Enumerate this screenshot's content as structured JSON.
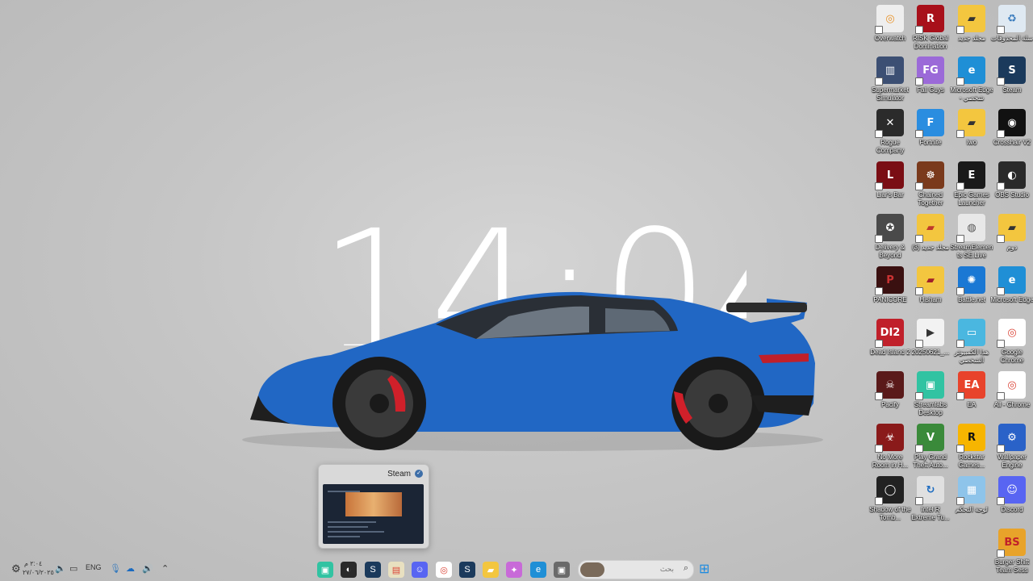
{
  "clock": {
    "time": "14:04"
  },
  "desktop_icons": [
    {
      "label": "Overwatch",
      "color": "#eeeeee",
      "fg": "#e8932a",
      "glyph": "◎"
    },
    {
      "label": "RISK Global Domination",
      "color": "#a8101a",
      "fg": "#ffffff",
      "glyph": "R"
    },
    {
      "label": "مجلد جديد",
      "color": "#f3c63f",
      "fg": "#333333",
      "glyph": "▰"
    },
    {
      "label": "سلة المحذوفات",
      "color": "#dfe9f2",
      "fg": "#3a7cbd",
      "glyph": "♻"
    },
    {
      "label": "Supermarket Simulator",
      "color": "#3c4f73",
      "fg": "#ffffff",
      "glyph": "▥"
    },
    {
      "label": "Fall Guys",
      "color": "#9b6ad8",
      "fg": "#ffffff",
      "glyph": "FG"
    },
    {
      "label": "Microsoft Edge - شخصي",
      "color": "#1f8fd6",
      "fg": "#ffffff",
      "glyph": "e"
    },
    {
      "label": "Steam",
      "color": "#1b3a5c",
      "fg": "#ffffff",
      "glyph": "S"
    },
    {
      "label": "Rogue Company",
      "color": "#2b2b2b",
      "fg": "#ffffff",
      "glyph": "✕"
    },
    {
      "label": "Fortnite",
      "color": "#2a8de0",
      "fg": "#ffffff",
      "glyph": "F"
    },
    {
      "label": "Iwo",
      "color": "#f3c63f",
      "fg": "#333333",
      "glyph": "▰"
    },
    {
      "label": "Crosshair V2",
      "color": "#111111",
      "fg": "#ffffff",
      "glyph": "◉"
    },
    {
      "label": "Liar's Bar",
      "color": "#7a0e14",
      "fg": "#ffffff",
      "glyph": "L"
    },
    {
      "label": "Chained Together",
      "color": "#7a3a1c",
      "fg": "#ffffff",
      "glyph": "☸"
    },
    {
      "label": "Epic Games Launcher",
      "color": "#1a1a1a",
      "fg": "#ffffff",
      "glyph": "E"
    },
    {
      "label": "OBS Studio",
      "color": "#2a2a2a",
      "fg": "#ffffff",
      "glyph": "◐"
    },
    {
      "label": "Delivery & Beyond",
      "color": "#4a4a4a",
      "fg": "#ffffff",
      "glyph": "✪"
    },
    {
      "label": "مجلد جديد (3)",
      "color": "#f3c63f",
      "fg": "#c0392b",
      "glyph": "▰"
    },
    {
      "label": "StreamElements SE.Live",
      "color": "#e8e8e8",
      "fg": "#555555",
      "glyph": "◍"
    },
    {
      "label": "دوم",
      "color": "#f3c63f",
      "fg": "#333333",
      "glyph": "▰"
    },
    {
      "label": "PANICORE",
      "color": "#3a1010",
      "fg": "#cc3333",
      "glyph": "P"
    },
    {
      "label": "Hisham",
      "color": "#f3c63f",
      "fg": "#a0202a",
      "glyph": "▰"
    },
    {
      "label": "Battle.net",
      "color": "#1a78d4",
      "fg": "#ffffff",
      "glyph": "✺"
    },
    {
      "label": "Microsoft Edge",
      "color": "#1f8fd6",
      "fg": "#ffffff",
      "glyph": "e"
    },
    {
      "label": "Dead Island 2",
      "color": "#c0202a",
      "fg": "#ffffff",
      "glyph": "DI2"
    },
    {
      "label": "20250621_...",
      "color": "#f2f2f2",
      "fg": "#333333",
      "glyph": "▶"
    },
    {
      "label": "هذا الكمبيوتر الشخصي",
      "color": "#4ab7e0",
      "fg": "#ffffff",
      "glyph": "▭"
    },
    {
      "label": "Google Chrome",
      "color": "#ffffff",
      "fg": "#db4437",
      "glyph": "◎"
    },
    {
      "label": "Pacify",
      "color": "#5a1a1a",
      "fg": "#ffffff",
      "glyph": "☠"
    },
    {
      "label": "Streamlabs Desktop",
      "color": "#31c3a2",
      "fg": "#ffffff",
      "glyph": "▣"
    },
    {
      "label": "EA",
      "color": "#e8432b",
      "fg": "#ffffff",
      "glyph": "EA"
    },
    {
      "label": "All - Chrome",
      "color": "#ffffff",
      "fg": "#db4437",
      "glyph": "◎"
    },
    {
      "label": "No More Room in H...",
      "color": "#8a1a1a",
      "fg": "#ffffff",
      "glyph": "☣"
    },
    {
      "label": "Play Grand Theft Auto...",
      "color": "#3a8a3a",
      "fg": "#ffffff",
      "glyph": "V"
    },
    {
      "label": "Rockstar Games...",
      "color": "#f7b500",
      "fg": "#111111",
      "glyph": "R"
    },
    {
      "label": "Wallpaper Engine",
      "color": "#2a62c8",
      "fg": "#ffffff",
      "glyph": "⚙"
    },
    {
      "label": "Shadow of the Tomb...",
      "color": "#222222",
      "fg": "#ffffff",
      "glyph": "◯"
    },
    {
      "label": "Intel R Extreme Tu...",
      "color": "#e0e0e0",
      "fg": "#1a6ac0",
      "glyph": "↻"
    },
    {
      "label": "لوحة التحكم",
      "color": "#8ec4ea",
      "fg": "#ffffff",
      "glyph": "▦"
    },
    {
      "label": "Discord",
      "color": "#5865f2",
      "fg": "#ffffff",
      "glyph": "☺"
    },
    {
      "label": "Burger Shift Team Sess",
      "color": "#e8a32a",
      "fg": "#c0202a",
      "glyph": "BS"
    }
  ],
  "steam_preview": {
    "title": "Steam"
  },
  "taskbar": {
    "search_placeholder": "بحث",
    "language": "ENG",
    "time": "٢:٠٤ م",
    "date": "٢٧/٠٦/٢٠٢٥",
    "apps": [
      {
        "name": "streamlabs",
        "color": "#31c3a2",
        "glyph": "▣"
      },
      {
        "name": "obs",
        "color": "#2a2a2a",
        "glyph": "◐"
      },
      {
        "name": "steam",
        "color": "#1b3a5c",
        "glyph": "S"
      },
      {
        "name": "file-manager",
        "color": "#e8e0c0",
        "glyph": "▤"
      },
      {
        "name": "discord",
        "color": "#5865f2",
        "glyph": "☺"
      },
      {
        "name": "chrome",
        "color": "#ffffff",
        "glyph": "◎"
      },
      {
        "name": "steam-2",
        "color": "#1b3a5c",
        "glyph": "S"
      },
      {
        "name": "file-explorer",
        "color": "#f3c63f",
        "glyph": "▰"
      },
      {
        "name": "copilot",
        "color": "#c86ad8",
        "glyph": "✦"
      },
      {
        "name": "edge",
        "color": "#1f8fd6",
        "glyph": "e"
      },
      {
        "name": "task-view",
        "color": "#6a6a6a",
        "glyph": "▣"
      }
    ]
  }
}
